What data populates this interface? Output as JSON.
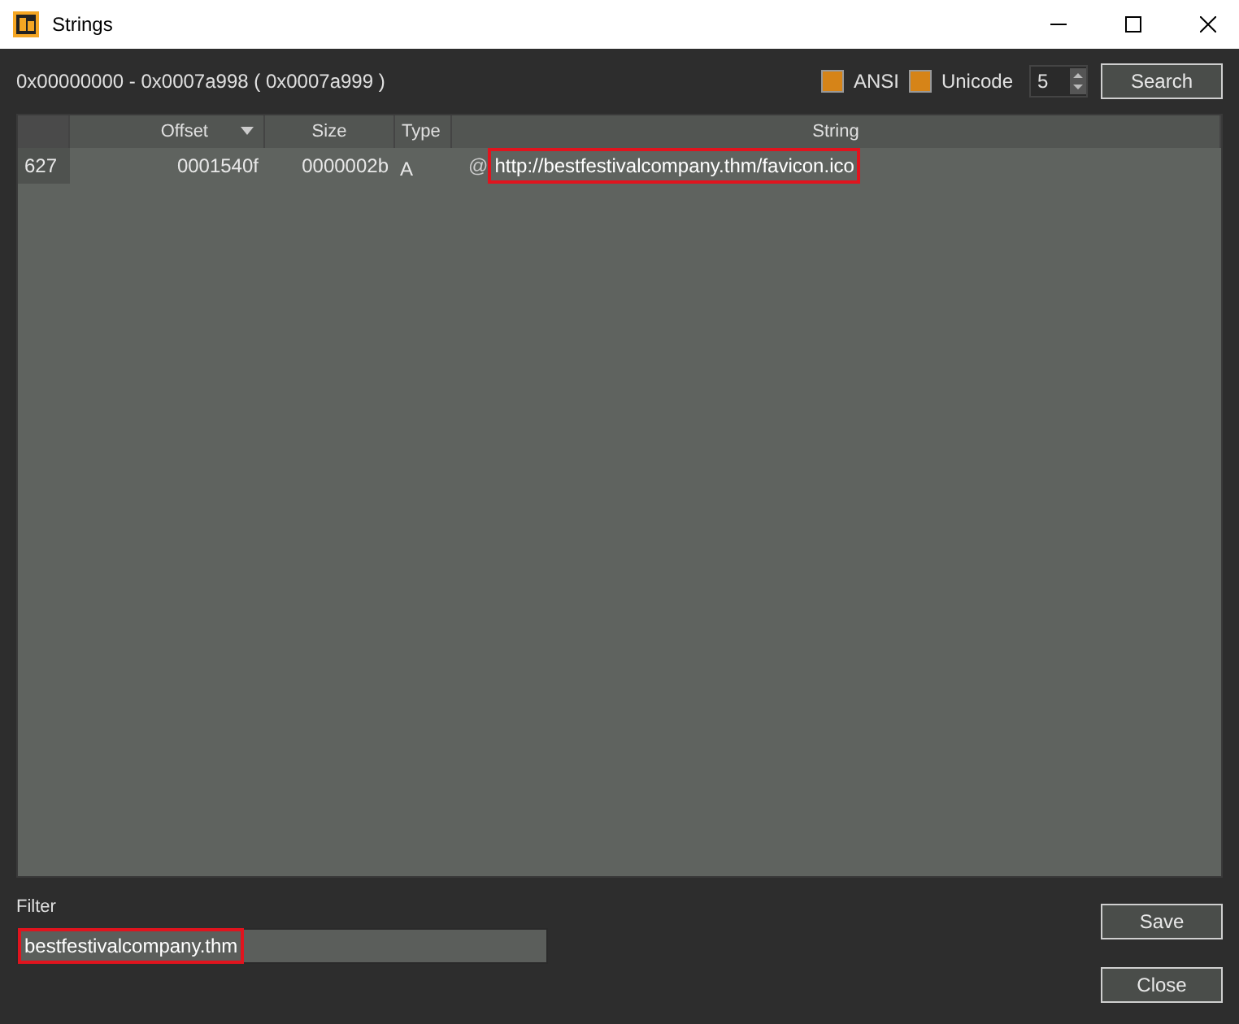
{
  "window": {
    "title": "Strings"
  },
  "range": "0x00000000 - 0x0007a998 ( 0x0007a999 )",
  "options": [
    {
      "label": "ANSI",
      "checked": true
    },
    {
      "label": "Unicode",
      "checked": true
    }
  ],
  "min_length": "5",
  "search_button": "Search",
  "table": {
    "columns": [
      {
        "label": "Offset",
        "sorted": true
      },
      {
        "label": "Size",
        "sorted": false
      },
      {
        "label": "Type",
        "sorted": false
      },
      {
        "label": "String",
        "sorted": false
      }
    ],
    "rows": [
      {
        "index": "627",
        "offset": "0001540f",
        "size": "0000002b",
        "type": "A",
        "prefix": "@",
        "string": "http://bestfestivalcompany.thm/favicon.ico",
        "highlighted": true
      }
    ]
  },
  "filter": {
    "label": "Filter",
    "value": "bestfestivalcompany.thm",
    "highlighted": true
  },
  "buttons": [
    "Save",
    "Close"
  ]
}
